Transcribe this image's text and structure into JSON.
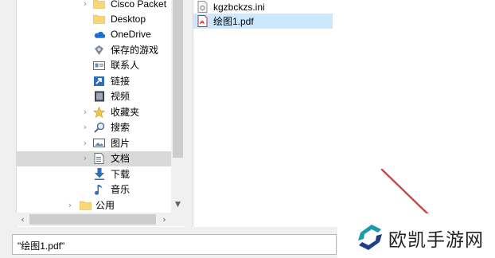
{
  "nav_tree": {
    "items": [
      {
        "label": "Cisco Packet",
        "icon": "folder-icon",
        "expand": "chevron-right"
      },
      {
        "label": "Desktop",
        "icon": "folder-icon",
        "expand": ""
      },
      {
        "label": "OneDrive",
        "icon": "onedrive-cloud-icon",
        "expand": ""
      },
      {
        "label": "保存的游戏",
        "icon": "saved-games-icon",
        "expand": ""
      },
      {
        "label": "联系人",
        "icon": "contacts-icon",
        "expand": ""
      },
      {
        "label": "链接",
        "icon": "links-icon",
        "expand": ""
      },
      {
        "label": "视频",
        "icon": "videos-icon",
        "expand": ""
      },
      {
        "label": "收藏夹",
        "icon": "favorites-star-icon",
        "expand": "chevron-right"
      },
      {
        "label": "搜索",
        "icon": "search-icon",
        "expand": "chevron-right"
      },
      {
        "label": "图片",
        "icon": "pictures-icon",
        "expand": "chevron-right"
      },
      {
        "label": "文档",
        "icon": "documents-icon",
        "expand": "chevron-right",
        "selected": true
      },
      {
        "label": "下载",
        "icon": "downloads-icon",
        "expand": ""
      },
      {
        "label": "音乐",
        "icon": "music-icon",
        "expand": ""
      },
      {
        "label": "公用",
        "icon": "folder-icon",
        "expand": "chevron-right"
      }
    ]
  },
  "file_list": {
    "items": [
      {
        "name": "kgzbckzs.ini",
        "icon": "ini-file-icon",
        "selected": false
      },
      {
        "name": "绘图1.pdf",
        "icon": "pdf-file-icon",
        "selected": true
      }
    ]
  },
  "filename_input": {
    "value": "\"绘图1.pdf\""
  },
  "watermark": {
    "text": "欧凯手游网",
    "icon": "brand-logo-icon"
  },
  "colors": {
    "selection_gray": "#d9d9d9",
    "selection_blue": "#cce8ff",
    "folder_yellow": "#f8d775",
    "accent_blue": "#1e6fd0",
    "watermark_teal": "#1a9ca8",
    "watermark_navy": "#1d3f8a"
  }
}
